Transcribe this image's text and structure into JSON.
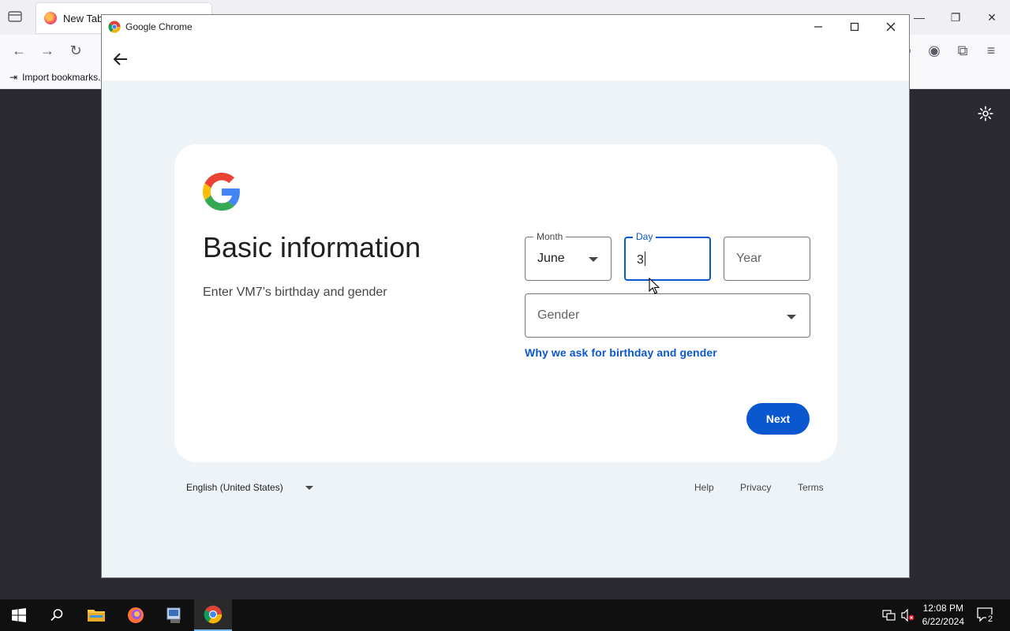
{
  "firefox": {
    "tab_title": "New Tab",
    "import_bookmarks": "Import bookmarks..."
  },
  "chrome": {
    "window_title": "Google Chrome"
  },
  "signup": {
    "heading": "Basic information",
    "subtitle": "Enter VM7’s birthday and gender",
    "month_label": "Month",
    "month_value": "June",
    "day_label": "Day",
    "day_value": "3",
    "year_placeholder": "Year",
    "gender_placeholder": "Gender",
    "why_link": "Why we ask for birthday and gender",
    "next_label": "Next"
  },
  "footer": {
    "language": "English (United States)",
    "help": "Help",
    "privacy": "Privacy",
    "terms": "Terms"
  },
  "taskbar": {
    "time": "12:08 PM",
    "date": "6/22/2024",
    "notification_count": "2"
  },
  "colors": {
    "accent": "#0b57d0",
    "page_bg": "#eef3f8"
  }
}
